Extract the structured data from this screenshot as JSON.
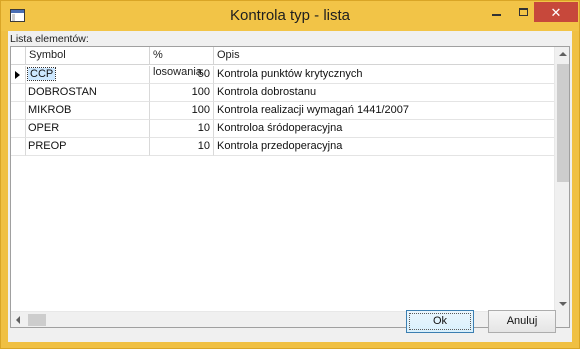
{
  "window": {
    "title": "Kontrola typ - lista",
    "accent_color": "#f2c447",
    "close_color": "#c7483b"
  },
  "titlebar_buttons": {
    "minimize_icon": "minimize-icon",
    "maximize_icon": "maximize-icon",
    "close_label": "✕"
  },
  "group": {
    "label": "Lista elementów:"
  },
  "table": {
    "columns": [
      "Symbol",
      "% losowania",
      "Opis"
    ],
    "rows": [
      {
        "symbol": "CCP",
        "pct": "50",
        "opis": "Kontrola punktów krytycznych",
        "current": true
      },
      {
        "symbol": "DOBROSTAN",
        "pct": "100",
        "opis": "Kontrola dobrostanu",
        "current": false
      },
      {
        "symbol": "MIKROB",
        "pct": "100",
        "opis": "Kontrola realizacji wymagań 1441/2007",
        "current": false
      },
      {
        "symbol": "OPER",
        "pct": "10",
        "opis": "Kontroloa śródoperacyjna",
        "current": false
      },
      {
        "symbol": "PREOP",
        "pct": "10",
        "opis": "Kontrola przedoperacyjna",
        "current": false
      }
    ]
  },
  "buttons": {
    "ok": "Ok",
    "cancel": "Anuluj"
  }
}
